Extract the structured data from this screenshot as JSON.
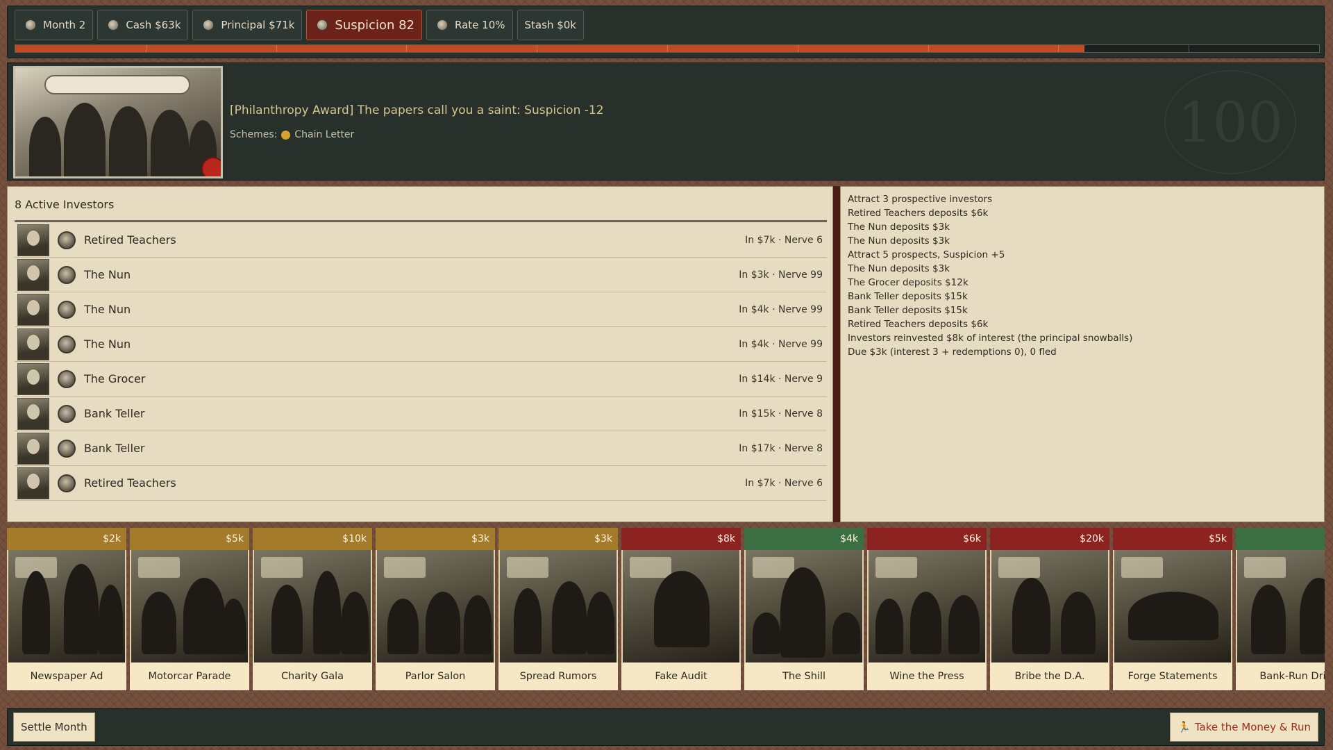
{
  "stats": [
    {
      "label": "Month 2",
      "icon": "coin-icon",
      "alert": false
    },
    {
      "label": "Cash $63k",
      "icon": "coin-icon",
      "alert": false
    },
    {
      "label": "Principal $71k",
      "icon": "coin-icon",
      "alert": false
    },
    {
      "label": "Suspicion 82",
      "icon": "coin-icon",
      "alert": true
    },
    {
      "label": "Rate 10%",
      "icon": "coin-icon",
      "alert": false
    },
    {
      "label": "Stash $0k",
      "icon": "",
      "alert": false
    }
  ],
  "suspicion_progress": 0.82,
  "banner": {
    "text": "[Philanthropy Award] The papers call you a saint: Suspicion -12",
    "schemes_label": "Schemes:",
    "scheme": "Chain Letter",
    "scheme_color": "#d8a32c"
  },
  "investors": {
    "title": "8 Active Investors",
    "rows": [
      {
        "name": "Retired Teachers",
        "meta": "In $7k · Nerve 6"
      },
      {
        "name": "The Nun",
        "meta": "In $3k · Nerve 99"
      },
      {
        "name": "The Nun",
        "meta": "In $4k · Nerve 99"
      },
      {
        "name": "The Nun",
        "meta": "In $4k · Nerve 99"
      },
      {
        "name": "The Grocer",
        "meta": "In $14k · Nerve 9"
      },
      {
        "name": "Bank Teller",
        "meta": "In $15k · Nerve 8"
      },
      {
        "name": "Bank Teller",
        "meta": "In $17k · Nerve 8"
      },
      {
        "name": "Retired Teachers",
        "meta": "In $7k · Nerve 6"
      }
    ]
  },
  "log": [
    "Attract 3 prospective investors",
    "Retired Teachers deposits $6k",
    "The Nun deposits $3k",
    "The Nun deposits $3k",
    "Attract 5 prospects, Suspicion +5",
    "The Nun deposits $3k",
    "The Grocer deposits $12k",
    "Bank Teller deposits $15k",
    "Bank Teller deposits $15k",
    "Retired Teachers deposits $6k",
    "Investors reinvested $8k of interest (the principal snowballs)",
    "Due $3k (interest 3 + redemptions 0), 0 fled"
  ],
  "cards": [
    {
      "label": "Newspaper Ad",
      "cost": "$2k",
      "tone": "gold"
    },
    {
      "label": "Motorcar Parade",
      "cost": "$5k",
      "tone": "gold"
    },
    {
      "label": "Charity Gala",
      "cost": "$10k",
      "tone": "gold"
    },
    {
      "label": "Parlor Salon",
      "cost": "$3k",
      "tone": "gold"
    },
    {
      "label": "Spread Rumors",
      "cost": "$3k",
      "tone": "gold"
    },
    {
      "label": "Fake Audit",
      "cost": "$8k",
      "tone": "red"
    },
    {
      "label": "The Shill",
      "cost": "$4k",
      "tone": "green"
    },
    {
      "label": "Wine the Press",
      "cost": "$6k",
      "tone": "red"
    },
    {
      "label": "Bribe the D.A.",
      "cost": "$20k",
      "tone": "red"
    },
    {
      "label": "Forge Statements",
      "cost": "$5k",
      "tone": "red"
    },
    {
      "label": "Bank-Run Drill",
      "cost": "",
      "tone": "green"
    }
  ],
  "bottom": {
    "settle_label": "Settle Month",
    "run_label": "Take the Money & Run",
    "run_icon": "running-man-icon"
  }
}
